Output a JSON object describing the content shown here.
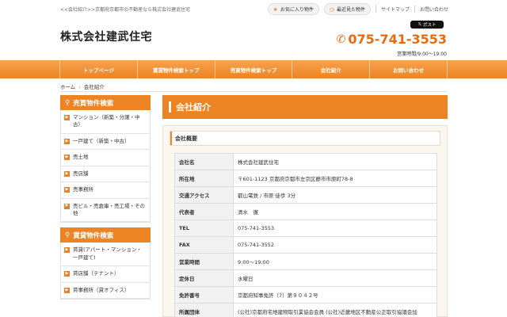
{
  "header": {
    "tagline": "<<会社紹介>>京都府京都市の不動産なら株式会社建武住宅",
    "favorites_label": "お気に入り物件",
    "recent_label": "最近見た物件",
    "sitemap_label": "サイトマップ",
    "contact_label": "お問い合わせ",
    "company_name": "株式会社建武住宅",
    "tweet_label": "ポスト",
    "phone": "075-741-3553",
    "hours": "営業時間/9:00～19:00"
  },
  "nav": {
    "items": [
      "トップページ",
      "賃貸物件検索トップ",
      "売買物件検索トップ",
      "会社紹介",
      "お問い合わせ"
    ]
  },
  "breadcrumb": {
    "home": "ホーム",
    "current": "会社紹介"
  },
  "sidebar": {
    "sale_title": "売買物件検索",
    "sale_items": [
      "マンション（新築・分譲・中古）",
      "一戸建て（新築・中古）",
      "売土地",
      "売店舗",
      "売事務所",
      "売ビル・売倉庫・売工場・その他"
    ],
    "rent_title": "賃貸物件検索",
    "rent_items": [
      "賃貸(アパート・マンション・一戸建て)",
      "賃店舗（テナント）",
      "賃事務所（貸オフィス）"
    ]
  },
  "main": {
    "page_title": "会社紹介",
    "section_title": "会社概要",
    "rows": [
      {
        "k": "会社名",
        "v": "株式会社建武住宅"
      },
      {
        "k": "所在地",
        "v": "〒601-1123 京都府京都市左京区静市市原町78-8"
      },
      {
        "k": "交通アクセス",
        "v": "叡山電鉄 / 市原 徒歩 3分"
      },
      {
        "k": "代表者",
        "v": "清水　徹"
      },
      {
        "k": "TEL",
        "v": "075-741-3553"
      },
      {
        "k": "FAX",
        "v": "075-741-3552"
      },
      {
        "k": "営業時間",
        "v": "9:00～19:00"
      },
      {
        "k": "定休日",
        "v": "水曜日"
      },
      {
        "k": "免許番号",
        "v": "京都府知事免許（7）第９０４２号"
      },
      {
        "k": "所属団体",
        "v": "(公社)京都府宅地建物取引業協会会員 (公社)近畿地区不動産公正取引協議会加"
      }
    ]
  },
  "colors": {
    "accent": "#ec8424",
    "phone": "#e66b0f"
  }
}
